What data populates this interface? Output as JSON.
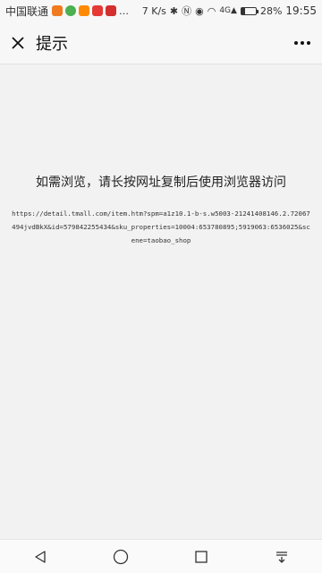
{
  "status_bar": {
    "carrier": "中国联通",
    "speed": "7 K/s",
    "battery_percent": "28%",
    "battery_level": 0.28,
    "time": "19:55",
    "signal_label": "4G"
  },
  "nav": {
    "title": "提示"
  },
  "main": {
    "hint": "如需浏览，请长按网址复制后使用浏览器访问",
    "url": "https://detail.tmall.com/item.htm?spm=a1z10.1-b-s.w5003-21241408146.2.72067494jvdBkX&id=579842255434&sku_properties=10004:653780895;5919063:6536025&scene=taobao_shop"
  },
  "colors": {
    "background": "#f2f2f2",
    "bar": "#f7f7f7"
  },
  "icons": {
    "close": "close-icon",
    "more": "more-icon",
    "back": "back-triangle-icon",
    "home": "home-circle-icon",
    "recents": "recents-square-icon",
    "notifications": "notification-pulldown-icon"
  }
}
